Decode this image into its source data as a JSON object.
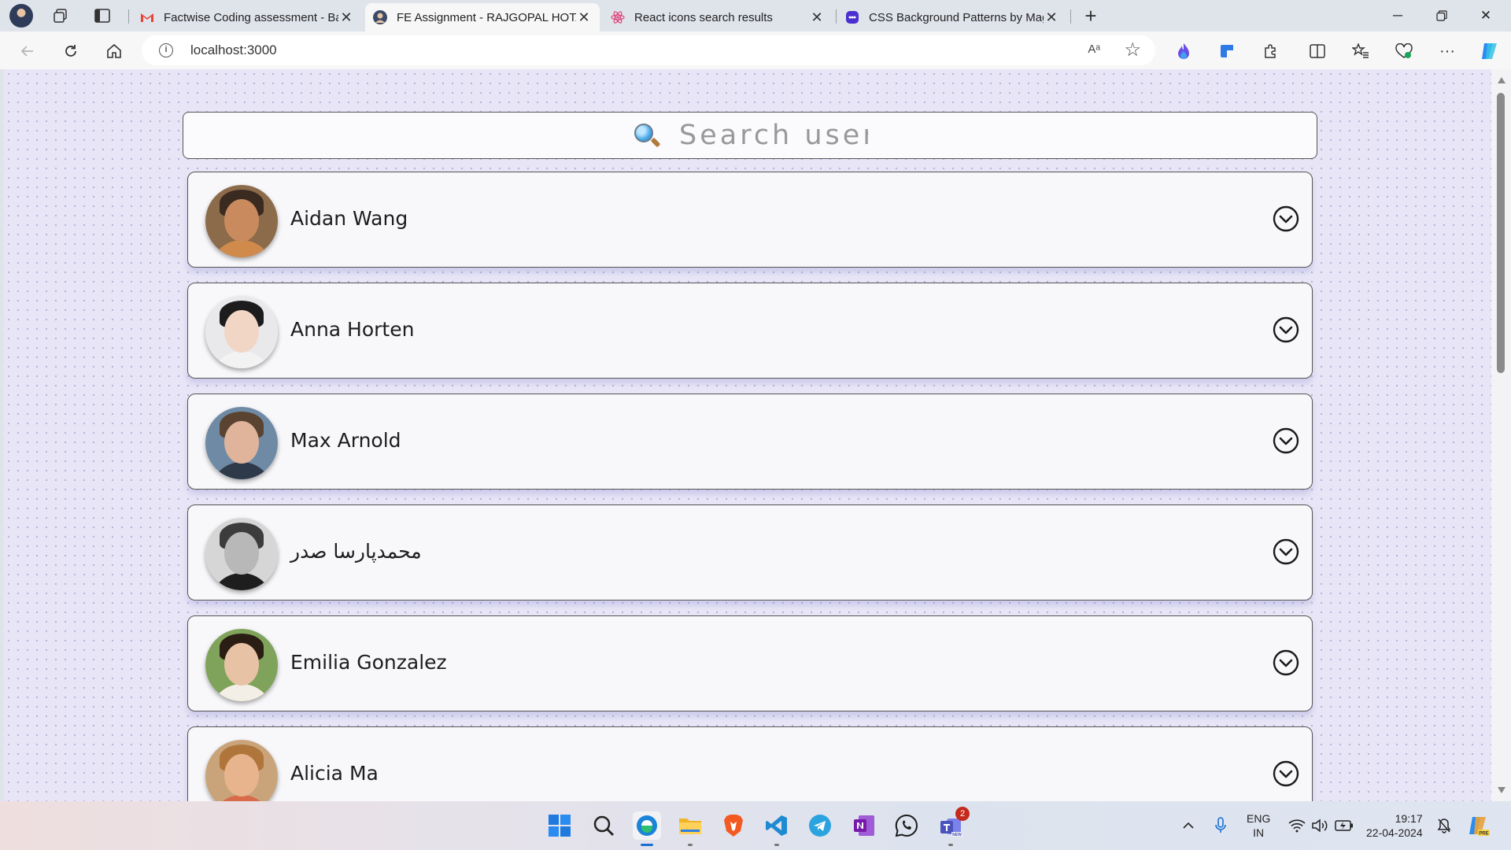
{
  "browser": {
    "tabs": [
      {
        "title": "Factwise Coding assessment - Ba",
        "favicon": "gmail-icon",
        "active": false
      },
      {
        "title": "FE Assignment - RAJGOPAL HOTA",
        "favicon": "profile-icon",
        "active": true
      },
      {
        "title": "React icons search results",
        "favicon": "react-icon",
        "active": false
      },
      {
        "title": "CSS Background Patterns by Mag",
        "favicon": "pattern-icon",
        "active": false
      }
    ],
    "address": "localhost:3000",
    "reader_label": "Aᵃ"
  },
  "page": {
    "search_placeholder": "Search user",
    "users": [
      {
        "name": "Aidan Wang",
        "skin": "#c98a5e",
        "hair": "#3a2a20",
        "shirt": "#d08a4c",
        "bg": "#8b6b4a"
      },
      {
        "name": "Anna Horten",
        "skin": "#f1d6c6",
        "hair": "#1c1c1c",
        "shirt": "#f2f2f2",
        "bg": "#e9e9ec"
      },
      {
        "name": "Max Arnold",
        "skin": "#e0b49a",
        "hair": "#5a4330",
        "shirt": "#2e3a4a",
        "bg": "#6f8aa5"
      },
      {
        "name": "محمدپارسا صدر",
        "skin": "#b8b8b8",
        "hair": "#3c3c3c",
        "shirt": "#1e1e1e",
        "bg": "#d6d6d6"
      },
      {
        "name": "Emilia Gonzalez",
        "skin": "#e8c2a4",
        "hair": "#2a1d14",
        "shirt": "#f4efe6",
        "bg": "#7fa35a"
      },
      {
        "name": "Alicia Ma",
        "skin": "#e7b48e",
        "hair": "#b0753a",
        "shirt": "#d86a4a",
        "bg": "#c9a47a"
      }
    ]
  },
  "taskbar": {
    "apps": [
      "windows-start-icon",
      "search-icon",
      "edge-icon",
      "file-explorer-icon",
      "brave-icon",
      "vscode-icon",
      "telegram-icon",
      "onenote-icon",
      "whatsapp-icon",
      "teams-icon"
    ],
    "teams_badge": "2",
    "lang_top": "ENG",
    "lang_bottom": "IN",
    "time": "19:17",
    "date": "22-04-2024"
  }
}
